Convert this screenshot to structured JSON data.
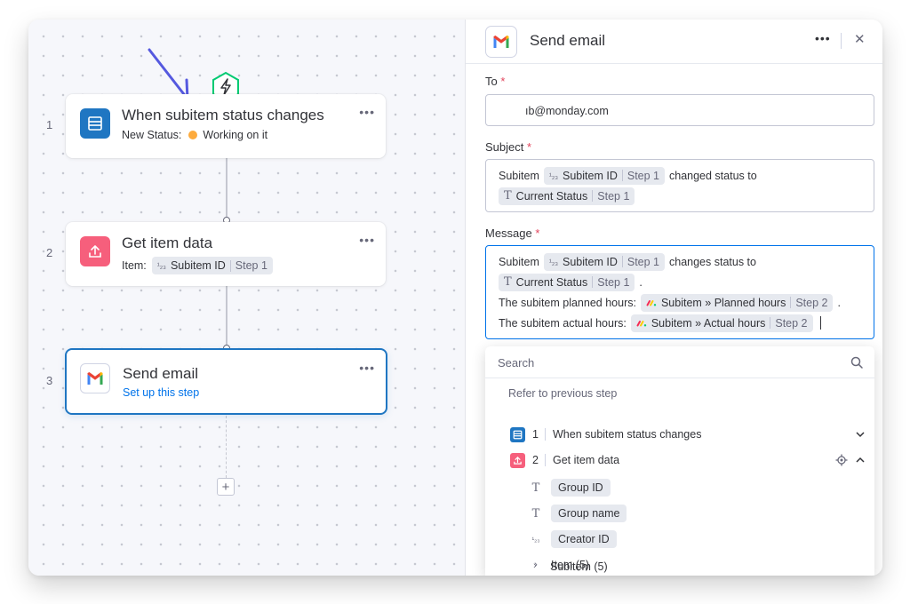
{
  "canvas": {
    "steps": [
      {
        "number": "1",
        "title": "When subitem status changes",
        "sub_label": "New Status:",
        "sub_value": "Working on it",
        "status_color": "#fdab3d",
        "icon": "board-icon",
        "icon_color": "#1f76c2"
      },
      {
        "number": "2",
        "title": "Get item data",
        "sub_label": "Item:",
        "token": {
          "type_icon": "¹₂₃",
          "label": "Subitem ID",
          "step": "Step 1"
        },
        "icon": "upload-icon",
        "icon_color": "#f65f7c"
      },
      {
        "number": "3",
        "title": "Send email",
        "sub_link": "Set up this step",
        "icon": "gmail-icon"
      }
    ],
    "trigger_icon": "lightning-icon",
    "annotation_arrow_color": "#5559df",
    "add_step_icon": "plus-icon"
  },
  "panel": {
    "title": "Send email",
    "to": {
      "label": "To",
      "required": "*",
      "value": "ıb@monday.com"
    },
    "subject": {
      "label": "Subject",
      "required": "*",
      "lines": [
        {
          "prefix": "Subitem",
          "token": {
            "type_icon": "¹₂₃",
            "label": "Subitem ID",
            "step": "Step 1"
          },
          "suffix": "changed status to"
        },
        {
          "prefix": "",
          "token": {
            "type_icon": "T",
            "label": "Current Status",
            "step": "Step 1"
          },
          "suffix": ""
        }
      ]
    },
    "message": {
      "label": "Message",
      "required": "*",
      "lines": [
        {
          "prefix": "Subitem",
          "token": {
            "type_icon": "¹₂₃",
            "label": "Subitem ID",
            "step": "Step 1"
          },
          "suffix": "changes status to"
        },
        {
          "prefix": "",
          "token": {
            "type_icon": "T",
            "label": "Current Status",
            "step": "Step 1"
          },
          "suffix": "."
        },
        {
          "prefix": "The subitem planned hours:",
          "token": {
            "type_icon": "monday-icon",
            "label": "Subitem » Planned hours",
            "step": "Step 2"
          },
          "suffix": "."
        },
        {
          "prefix": "The subitem actual hours:",
          "token": {
            "type_icon": "monday-icon",
            "label": "Subitem » Actual hours",
            "step": "Step 2"
          },
          "suffix": "."
        }
      ]
    },
    "dropdown": {
      "search_placeholder": "Search",
      "heading": "Refer to previous step",
      "steps": [
        {
          "number": "1",
          "label": "When subitem status changes",
          "expanded": false,
          "icon_color": "#1f76c2"
        },
        {
          "number": "2",
          "label": "Get item data",
          "expanded": true,
          "icon_color": "#f65f7c"
        }
      ],
      "fields": [
        {
          "type": "T",
          "label": "Group ID",
          "kind": "pill"
        },
        {
          "type": "T",
          "label": "Group name",
          "kind": "pill"
        },
        {
          "type": "¹₂₃",
          "label": "Creator ID",
          "kind": "pill"
        },
        {
          "type": "›",
          "label": "Item (5)",
          "kind": "group"
        },
        {
          "type": "›",
          "label": "Subitem (5)",
          "kind": "group"
        }
      ]
    }
  },
  "colors": {
    "accent": "#0073ea",
    "selected_border": "#1f76c2",
    "required": "#e2445c"
  }
}
